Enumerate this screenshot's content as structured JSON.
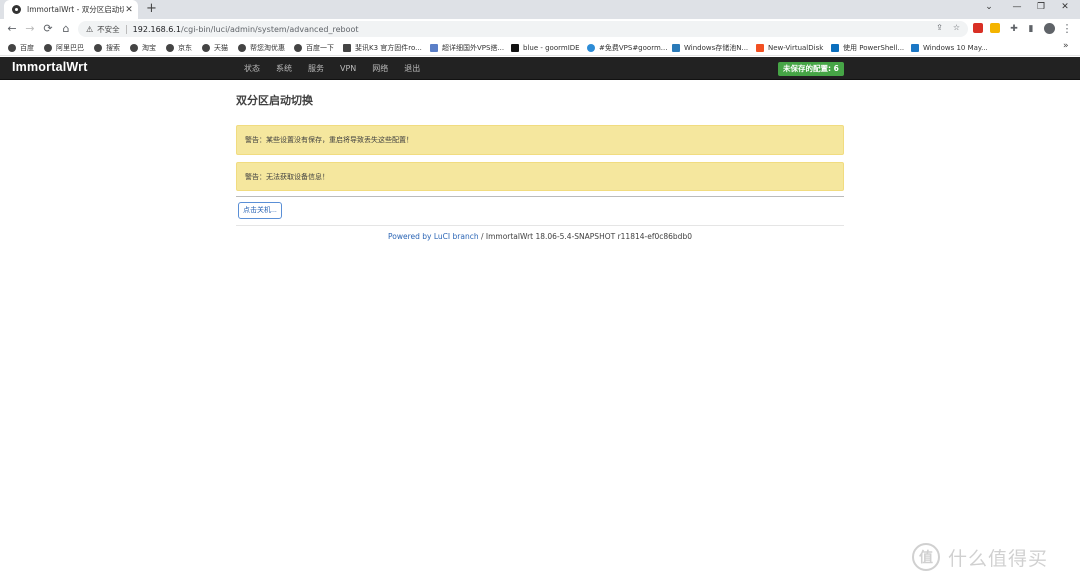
{
  "browser": {
    "tab": {
      "title": "ImmortalWrt - 双分区启动切换",
      "close": "✕"
    },
    "new_tab": "+",
    "window_controls": {
      "minimize": "—",
      "restore": "❐",
      "close": "✕",
      "dropdown": "⌄"
    },
    "nav": {
      "back": "←",
      "forward": "→",
      "reload": "⟳",
      "home": "⌂"
    },
    "omnibox": {
      "security_icon": "⚠",
      "security_text": "不安全",
      "url_host": "192.168.6.1",
      "url_path": "/cgi-bin/luci/admin/system/advanced_reboot",
      "share_icon": "⇪",
      "star_icon": "☆"
    },
    "toolbar_icons": {
      "extensions": "✚",
      "sidebar": "▮",
      "menu": "⋮"
    },
    "bookmarks": [
      {
        "label": "百度"
      },
      {
        "label": "阿里巴巴"
      },
      {
        "label": "搜索"
      },
      {
        "label": "淘宝"
      },
      {
        "label": "京东"
      },
      {
        "label": "天猫"
      },
      {
        "label": "帮您淘优惠"
      },
      {
        "label": "百度一下"
      },
      {
        "label": "斐讯K3 官方固件ro..."
      },
      {
        "label": "超详细国外VPS搭..."
      },
      {
        "label": "blue - goormIDE"
      },
      {
        "label": "#免费VPS#goorm..."
      },
      {
        "label": "Windows存储池N..."
      },
      {
        "label": "New-VirtualDisk"
      },
      {
        "label": "使用 PowerShell..."
      },
      {
        "label": "Windows 10 May..."
      }
    ],
    "bookmarks_more": "»"
  },
  "luci": {
    "brand": "ImmortalWrt",
    "menu": [
      "状态",
      "系统",
      "服务",
      "VPN",
      "网络",
      "退出"
    ],
    "unsaved_badge": "未保存的配置: 6"
  },
  "page": {
    "title": "双分区启动切换",
    "alerts": [
      "警告：某些设置没有保存，重启将导致丢失这些配置！",
      "警告：无法获取设备信息！"
    ],
    "action_button": "点击关机...",
    "footer": {
      "link_text": "Powered by LuCI branch",
      "version_text": " / ImmortalWrt 18.06-5.4-SNAPSHOT r11814-ef0c86bdb0"
    }
  },
  "watermark": {
    "logo": "值",
    "text": "什么值得买"
  }
}
